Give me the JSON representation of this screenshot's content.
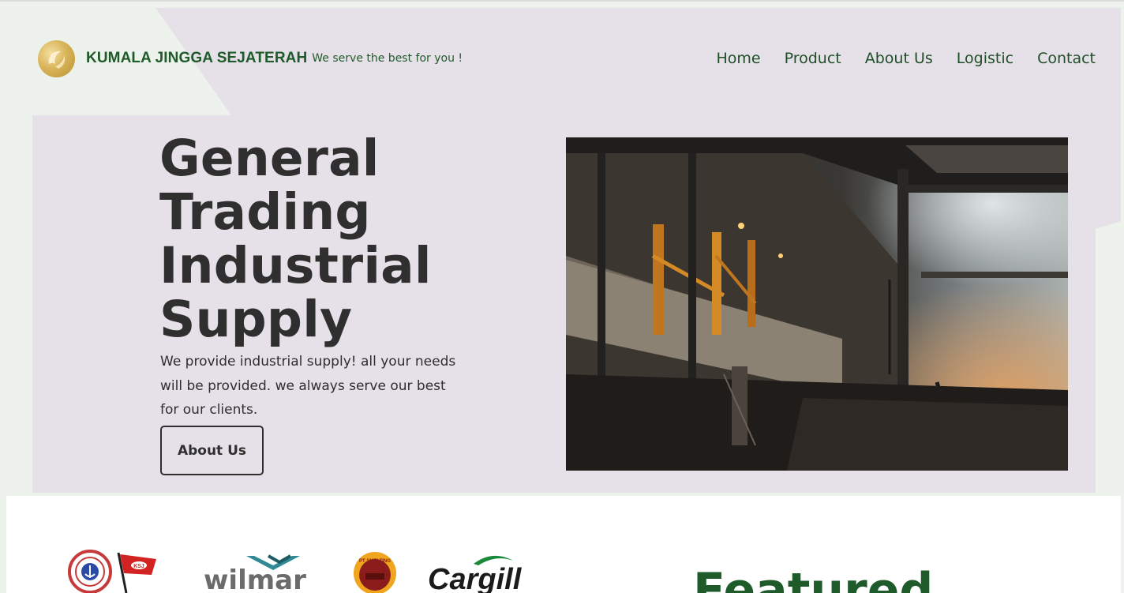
{
  "header": {
    "brand": "KUMALA JINGGA SEJATERAH",
    "tagline": "We serve the best for you !",
    "logo_icon": "gold-leaf-logo-icon"
  },
  "nav": {
    "items": [
      {
        "label": "Home"
      },
      {
        "label": "Product"
      },
      {
        "label": "About Us"
      },
      {
        "label": "Logistic"
      },
      {
        "label": "Contact"
      }
    ]
  },
  "hero": {
    "title_lines": [
      "General",
      "Trading",
      "Industrial",
      "Supply"
    ],
    "description": "We provide industrial supply! all your needs will be provided. we always serve our best for our clients.",
    "button_label": "About Us",
    "image_icon": "industrial-plant-photo"
  },
  "partners": {
    "items": [
      {
        "name": "anchor-emblem-flag-logo",
        "text": "KSJ"
      },
      {
        "name": "wilmar-logo",
        "text": "wilmar"
      },
      {
        "name": "pt-smelting-logo",
        "text": "PT SMELTING"
      },
      {
        "name": "cargill-logo",
        "text": "Cargill"
      }
    ]
  },
  "featured": {
    "heading": "Featured"
  },
  "colors": {
    "brand_green": "#1f5a2a",
    "hero_bg": "#e6e1e8",
    "page_bg": "#edf3ec",
    "text_dark": "#2f2f2f"
  }
}
